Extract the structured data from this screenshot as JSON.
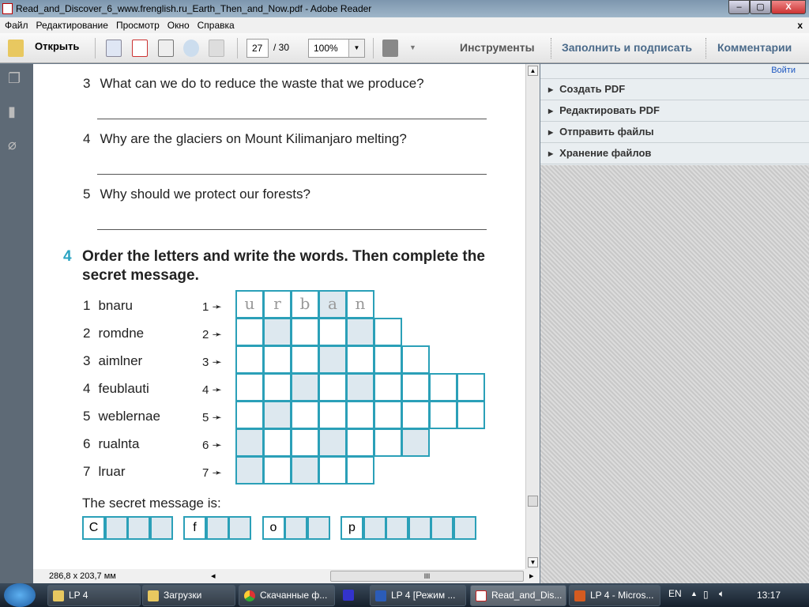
{
  "window": {
    "title": "Read_and_Discover_6_www.frenglish.ru_Earth_Then_and_Now.pdf - Adobe Reader",
    "minimize": "–",
    "maximize": "▢",
    "close": "X"
  },
  "menu": [
    "Файл",
    "Редактирование",
    "Просмотр",
    "Окно",
    "Справка"
  ],
  "menu_close": "x",
  "toolbar": {
    "open": "Открыть",
    "page": "27",
    "total": "/ 30",
    "zoom": "100%",
    "tools": "Инструменты",
    "fill_sign": "Заполнить и подписать",
    "comments": "Комментарии"
  },
  "right_panel": {
    "login": "Войти",
    "items": [
      "Создать PDF",
      "Редактировать PDF",
      "Отправить файлы",
      "Хранение файлов"
    ]
  },
  "document": {
    "questions": [
      {
        "n": "3",
        "text": "What can we do to reduce the waste that we produce?"
      },
      {
        "n": "4",
        "text": "Why are the glaciers on Mount Kilimanjaro melting?"
      },
      {
        "n": "5",
        "text": "Why should we protect our forests?"
      }
    ],
    "exercise": {
      "n": "4",
      "title": "Order the letters and write the words. Then complete the secret message."
    },
    "words": [
      {
        "n": "1",
        "w": "bnaru"
      },
      {
        "n": "2",
        "w": "romdne"
      },
      {
        "n": "3",
        "w": "aimlner"
      },
      {
        "n": "4",
        "w": "feublauti"
      },
      {
        "n": "5",
        "w": "weblernae"
      },
      {
        "n": "6",
        "w": "rualnta"
      },
      {
        "n": "7",
        "w": "lruar"
      }
    ],
    "arrows": [
      "1 ➛",
      "2 ➛",
      "3 ➛",
      "4 ➛",
      "5 ➛",
      "6 ➛",
      "7 ➛"
    ],
    "grid": [
      {
        "len": 5,
        "shaded": [
          3
        ],
        "letters": [
          "u",
          "r",
          "b",
          "a",
          "n"
        ]
      },
      {
        "len": 6,
        "shaded": [
          1,
          4
        ]
      },
      {
        "len": 7,
        "shaded": [
          3
        ]
      },
      {
        "len": 9,
        "shaded": [
          2,
          4
        ]
      },
      {
        "len": 9,
        "shaded": [
          1
        ]
      },
      {
        "len": 7,
        "shaded": [
          0,
          3,
          6
        ]
      },
      {
        "len": 5,
        "shaded": [
          0,
          2
        ]
      }
    ],
    "secret_label": "The secret message is:",
    "secret_groups": [
      {
        "len": 4,
        "first": "C"
      },
      {
        "len": 3,
        "first": "f"
      },
      {
        "len": 3,
        "first": "o"
      },
      {
        "len": 6,
        "first": "p"
      }
    ]
  },
  "status": {
    "size": "286,8 x 203,7 мм",
    "hscroll": "III"
  },
  "taskbar": {
    "items": [
      "LP 4",
      "Загрузки",
      "Скачанные ф...",
      "",
      "LP 4 [Режим ...",
      "Read_and_Dis...",
      "LP 4 - Micros..."
    ],
    "lang": "EN",
    "tray": "▲",
    "clock": "13:17"
  }
}
